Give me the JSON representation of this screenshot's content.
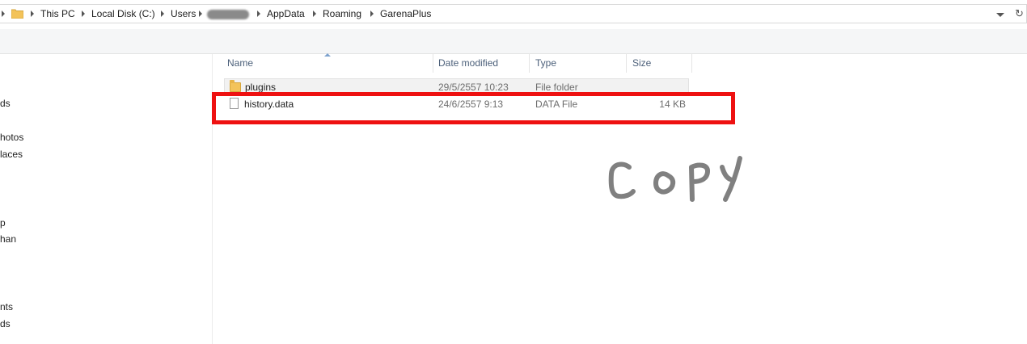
{
  "address_bar": {
    "crumbs": [
      "This PC",
      "Local Disk (C:)",
      "Users",
      "AppData",
      "Roaming",
      "GarenaPlus"
    ]
  },
  "nav": {
    "items": [
      "ds",
      "hotos",
      "laces",
      "p",
      "han",
      "nts",
      "ds"
    ]
  },
  "columns": {
    "name": "Name",
    "date_modified": "Date modified",
    "type": "Type",
    "size": "Size"
  },
  "files": [
    {
      "name": "plugins",
      "date": "29/5/2557 10:23",
      "type": "File folder",
      "size": "",
      "icon": "folder-icon"
    },
    {
      "name": "history.data",
      "date": "24/6/2557 9:13",
      "type": "DATA File",
      "size": "14 KB",
      "icon": "file-icon"
    }
  ],
  "annotation": {
    "text": "COPY",
    "color": "#808080",
    "highlight_color": "#ee1111"
  }
}
